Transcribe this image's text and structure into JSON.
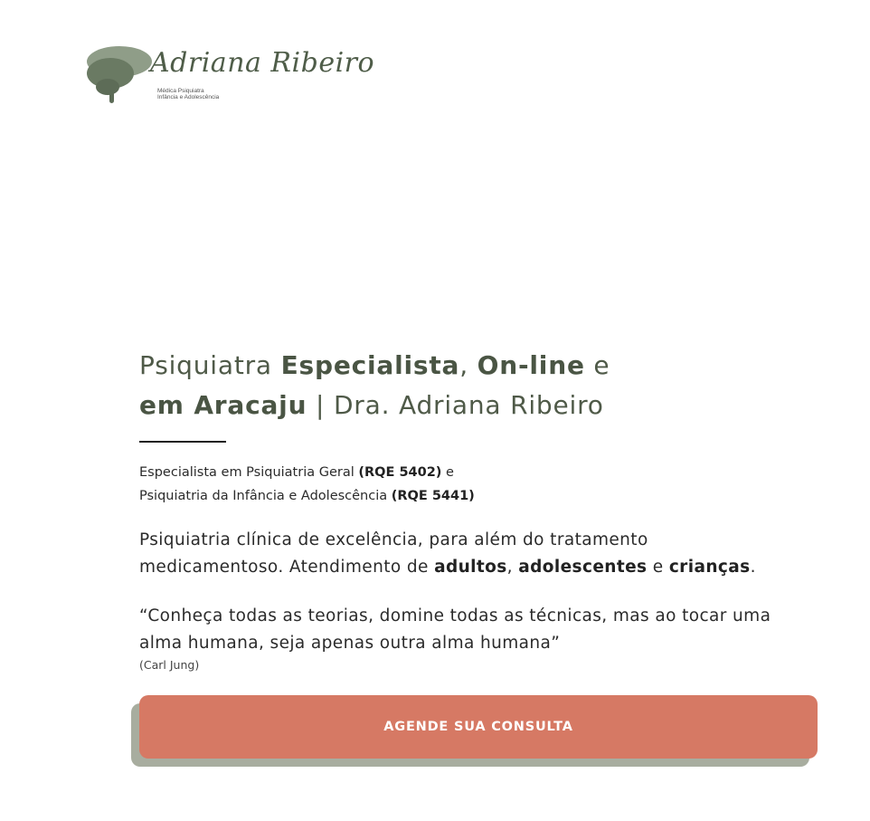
{
  "logo": {
    "name": "Adriana Ribeiro",
    "subtitle_line1": "Médica Psiquiatra",
    "subtitle_line2": "Infância e Adolescência",
    "icon": "brain-head-icon",
    "color": "#6f7f67"
  },
  "hero": {
    "title_part1": "Psiquiatra ",
    "title_bold1": "Especialista",
    "title_part2": ", ",
    "title_bold2": "On-line",
    "title_part3": " e",
    "title_bold3": "em Aracaju",
    "title_part4": " | Dra. Adriana Ribeiro",
    "specialty1_text": "Especialista em Psiquiatria Geral ",
    "specialty1_code": "(RQE 5402)",
    "specialty1_suffix": " e",
    "specialty2_text": "Psiquiatria da Infância e Adolescência ",
    "specialty2_code": "(RQE 5441)",
    "intro_part1": "Psiquiatria clínica de excelência, para além do tratamento medicamentoso. Atendimento de ",
    "intro_bold1": "adultos",
    "intro_sep1": ", ",
    "intro_bold2": "adolescentes",
    "intro_sep2": " e ",
    "intro_bold3": "crianças",
    "intro_end": ".",
    "quote": "“Conheça todas as teorias, domine todas as técnicas, mas ao tocar uma alma humana, seja apenas outra alma humana”",
    "quote_author": "(Carl Jung)"
  },
  "cta": {
    "label": "AGENDE SUA CONSULTA"
  },
  "colors": {
    "title": "#4f5a48",
    "button": "#d67964",
    "button_shadow": "#a8ad9f",
    "text": "#2b2b2b"
  }
}
